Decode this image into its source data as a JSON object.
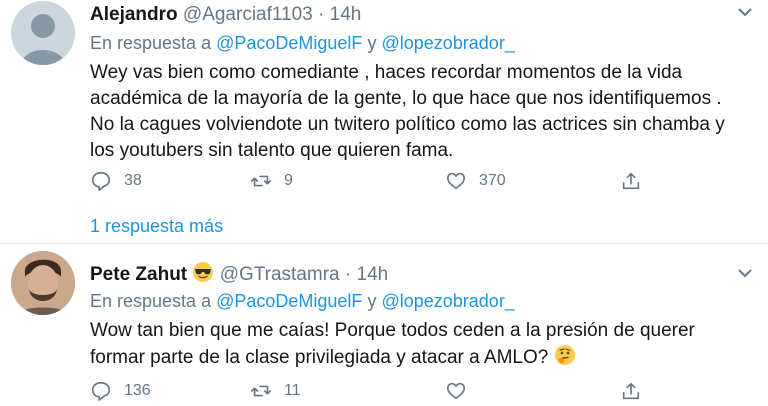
{
  "tweets": [
    {
      "name": "Alejandro",
      "handle": "@Agarciaf1103",
      "separator": "·",
      "time": "14h",
      "reply_prefix": "En respuesta a",
      "mention1": "@PacoDeMiguelF",
      "reply_and": "y",
      "mention2": "@lopezobrador_",
      "lines": [
        "Wey vas bien como comediante , haces recordar momentos de la vida",
        "académica de la mayoría de la gente, lo que hace que nos identifiquemos .",
        "No la cagues volviendote un twitero político como las actrices sin chamba y",
        "los youtubers sin talento que quieren fama."
      ],
      "replies": "38",
      "retweets": "9",
      "likes": "370",
      "more_replies": "1 respuesta más"
    },
    {
      "name": "Pete Zahut",
      "handle": "@GTrastamra",
      "separator": "·",
      "time": "14h",
      "reply_prefix": "En respuesta a",
      "mention1": "@PacoDeMiguelF",
      "reply_and": "y",
      "mention2": "@lopezobrador_",
      "lines": [
        "Wow tan bien que me caías! Porque todos ceden a la presión de querer",
        "formar parte de la clase privilegiada y atacar a AMLO?"
      ],
      "replies": "136",
      "retweets": "11",
      "likes": ""
    }
  ],
  "icons": {
    "reply": "reply-icon",
    "retweet": "retweet-icon",
    "like": "like-icon",
    "share": "share-icon",
    "caret": "chevron-down-icon",
    "name_emoji": "sunglasses-emoji",
    "text_emoji": "thinking-emoji"
  },
  "colors": {
    "link": "#1b95e0",
    "secondary_text": "#657786",
    "primary_text": "#14171a",
    "separator": "#e6ecf0"
  }
}
